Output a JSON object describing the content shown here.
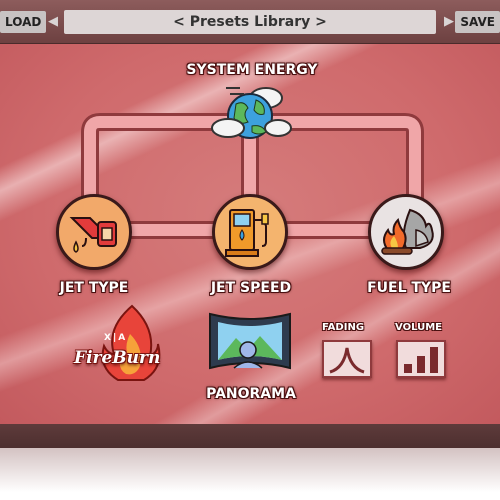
{
  "header": {
    "load_label": "LOAD",
    "save_label": "SAVE",
    "preset_label": "< Presets Library >",
    "prev_arrow": "◀",
    "next_arrow": "▶"
  },
  "nodes": {
    "system_energy": "SYSTEM ENERGY",
    "jet_type": "JET TYPE",
    "jet_speed": "JET SPEED",
    "fuel_type": "FUEL TYPE",
    "panorama": "PANORAMA"
  },
  "controls": {
    "fading": "FADING",
    "volume": "VOLUME"
  },
  "logo": {
    "mark": "X|A",
    "name": "FireBurn"
  },
  "icons": {
    "system_energy": "globe-with-clouds-icon",
    "jet_type": "gas-nozzle-icon",
    "jet_speed": "fuel-pump-icon",
    "fuel_type": "fire-and-rocks-icon",
    "panorama": "panorama-picture-icon",
    "fading": "peak-curve-icon",
    "volume": "volume-bars-icon",
    "logo": "flame-logo-icon"
  },
  "colors": {
    "background": "#cf6a6c",
    "pipe": "#f0a6a8",
    "pipe_edge": "#9a4044",
    "node_jet_type": "#f2a96a",
    "node_jet_speed": "#f4b46e",
    "node_fuel_type": "#e9e3e3",
    "topbar": "#7a4d4d"
  }
}
